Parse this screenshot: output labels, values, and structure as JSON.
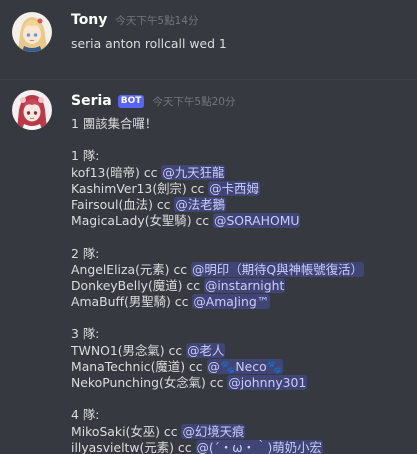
{
  "colors": {
    "background": "#36393f",
    "text": "#dcddde",
    "username": "#ffffff",
    "timestamp": "#72767d",
    "bot_tag": "#5865f2",
    "mention_text": "#c9cdfb"
  },
  "messages": [
    {
      "author": "Tony",
      "timestamp": "今天下午5點14分",
      "avatar_icon": "anime-girl-blonde-avatar",
      "text": "seria anton rollcall wed 1"
    },
    {
      "author": "Seria",
      "bot_tag": "BOT",
      "timestamp": "今天下午5點20分",
      "avatar_icon": "anime-girl-red-hair-avatar",
      "intro": "1 團該集合囉！",
      "teams": [
        {
          "label": "1 隊:",
          "members": [
            {
              "name": "kof13(暗帝) cc ",
              "mention": "@九天狂龍"
            },
            {
              "name": "KashimVer13(劍宗) cc ",
              "mention": "@卡西姆"
            },
            {
              "name": "Fairsoul(血法) cc ",
              "mention": "@法老鵝"
            },
            {
              "name": "MagicaLady(女聖騎) cc ",
              "mention": "@SORAHOMU"
            }
          ]
        },
        {
          "label": "2 隊:",
          "members": [
            {
              "name": "AngelEliza(元素) cc ",
              "mention": "@明印（期待Q與神帳號復活）"
            },
            {
              "name": "DonkeyBelly(魔道) cc ",
              "mention": "@instarnight"
            },
            {
              "name": "AmaBuff(男聖騎) cc ",
              "mention": "@AmaJing™"
            }
          ]
        },
        {
          "label": "3 隊:",
          "members": [
            {
              "name": "TWNO1(男念氣) cc ",
              "mention": "@老人"
            },
            {
              "name": "ManaTechnic(魔道) cc ",
              "mention": "@🐾Neco🐾"
            },
            {
              "name": "NekoPunching(女念氣) cc ",
              "mention": "@johnny301"
            }
          ]
        },
        {
          "label": "4 隊:",
          "members": [
            {
              "name": "MikoSaki(女巫) cc ",
              "mention": "@幻境天痕"
            },
            {
              "name": "illyasvieltw(元素) cc ",
              "mention": "@(´・ω・｀)萌奶小宏"
            }
          ]
        }
      ]
    }
  ]
}
